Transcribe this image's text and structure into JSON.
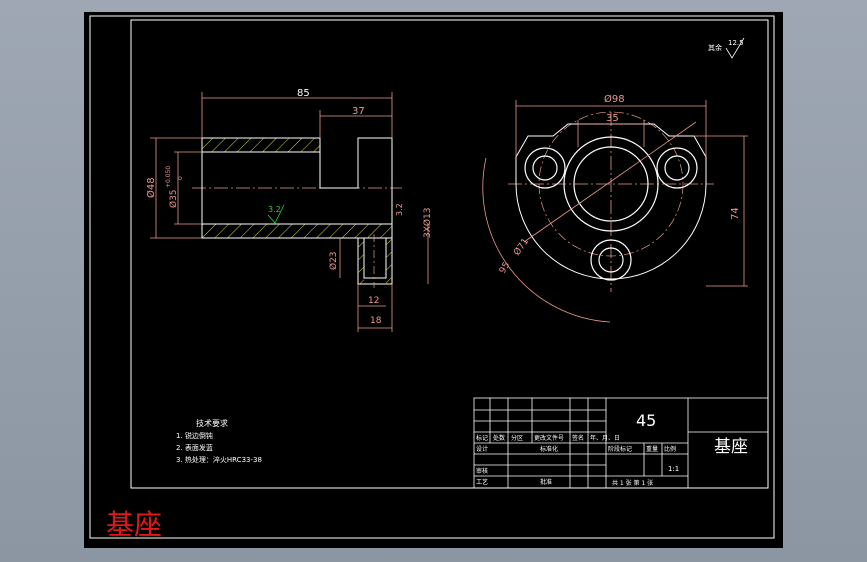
{
  "colors": {
    "background": "#9aa3ae",
    "sheet": "#000000",
    "frame": "#ffffff",
    "dimension": "#e89a8a",
    "part_lines": "#ffffff",
    "hatch": "#d8d830",
    "roughness": "#30d030",
    "caption": "#e01818"
  },
  "side_view": {
    "dim_total_length": "85",
    "dim_flange_length": "37",
    "dim_outer_dia": "Ø48",
    "dim_bore_dia": "Ø35",
    "dim_bore_tol_upper": "+0.050",
    "dim_bore_tol_lower": "0",
    "roughness_bore": "3.2",
    "roughness_face": "3.2",
    "dim_holes": "3XØ13",
    "dim_cbore_dia": "Ø23",
    "dim_cbore_depth": "12",
    "dim_flange_thickness": "18"
  },
  "front_view": {
    "dim_outer_dia": "Ø98",
    "dim_bore": "35",
    "dim_height": "74",
    "dim_pcd": "Ø71",
    "dim_arc": "95"
  },
  "roughness_note": {
    "label": "其余",
    "value": "12.5"
  },
  "tech_requirements": {
    "title": "技术要求",
    "items": [
      "1. 锐边倒钝",
      "2. 表面发蓝",
      "3. 热处理：淬火HRC33-38"
    ]
  },
  "title_block": {
    "material": "45",
    "part_name": "基座",
    "scale": "1:1",
    "row_labels": [
      "标记",
      "处数",
      "分区",
      "更改文件号",
      "签名",
      "年、月、日"
    ],
    "design_label": "设计",
    "standard_label": "标准化",
    "review_label": "审核",
    "process_label": "工艺",
    "approve_label": "批准",
    "stage_label": "阶段标记",
    "weight_label": "重量",
    "scale_label": "比例",
    "sheets_label": "共 1 张  第 1 张"
  },
  "caption": "基座"
}
